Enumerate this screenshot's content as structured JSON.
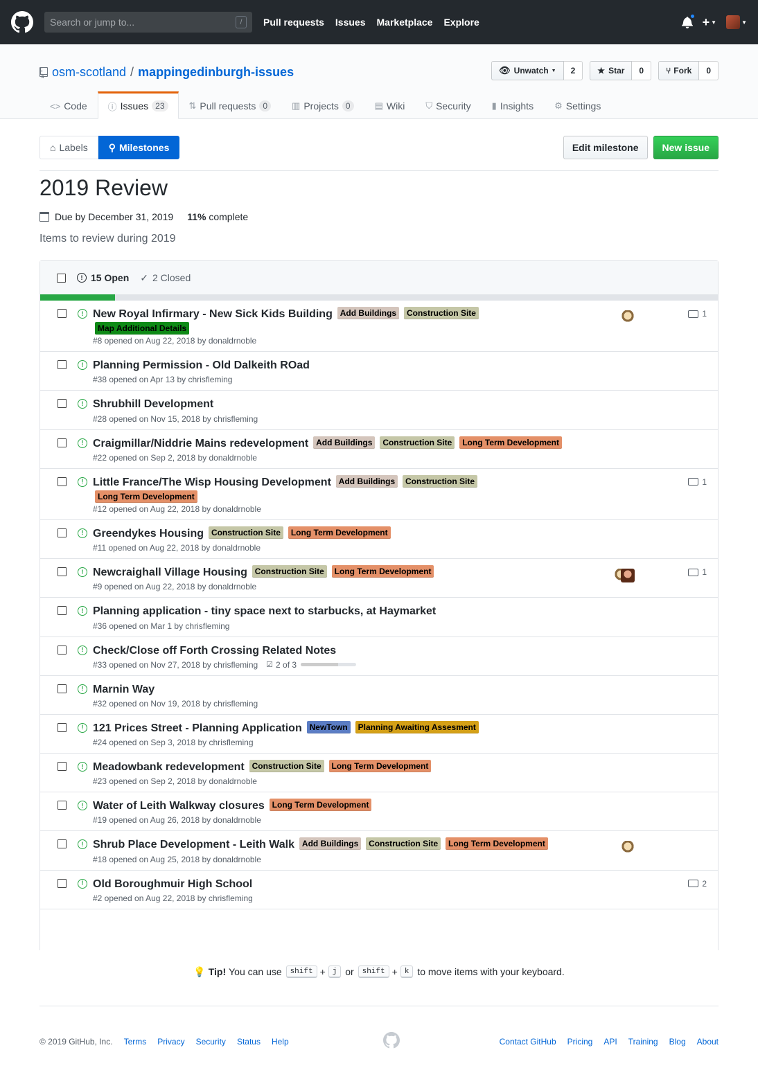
{
  "header": {
    "search_placeholder": "Search or jump to...",
    "search_key": "/",
    "nav": [
      "Pull requests",
      "Issues",
      "Marketplace",
      "Explore"
    ],
    "plus": "+"
  },
  "repo": {
    "owner": "osm-scotland",
    "separator": "/",
    "name": "mappingedinburgh-issues",
    "watch_label": "Unwatch",
    "watch_count": "2",
    "star_label": "Star",
    "star_count": "0",
    "fork_label": "Fork",
    "fork_count": "0"
  },
  "reponav": [
    {
      "label": "Code",
      "icon": "code-icon",
      "glyph": "<>",
      "counter": ""
    },
    {
      "label": "Issues",
      "icon": "issue-opened-icon",
      "glyph": "ⓘ",
      "counter": "23"
    },
    {
      "label": "Pull requests",
      "icon": "git-pull-request-icon",
      "glyph": "⇅",
      "counter": "0"
    },
    {
      "label": "Projects",
      "icon": "project-icon",
      "glyph": "▥",
      "counter": "0"
    },
    {
      "label": "Wiki",
      "icon": "book-icon",
      "glyph": "▤",
      "counter": ""
    },
    {
      "label": "Security",
      "icon": "shield-icon",
      "glyph": "⛉",
      "counter": ""
    },
    {
      "label": "Insights",
      "icon": "graph-icon",
      "glyph": "▮",
      "counter": ""
    },
    {
      "label": "Settings",
      "icon": "gear-icon",
      "glyph": "⚙",
      "counter": ""
    }
  ],
  "subnav": {
    "labels": "Labels",
    "milestones": "Milestones",
    "edit_milestone": "Edit milestone",
    "new_issue": "New issue"
  },
  "milestone": {
    "title": "2019 Review",
    "due": "Due by December 31, 2019",
    "percent": "11%",
    "percent_suffix": " complete",
    "progress_fraction": 0.11,
    "description": "Items to review during 2019"
  },
  "states": {
    "open": "15 Open",
    "closed": "2 Closed"
  },
  "label_colors": {
    "Add Buildings": "#d4c5bc",
    "Construction Site": "#c5c7a7",
    "Map Additional Details": "#0e8a16",
    "Long Term Development": "#e49068",
    "NewTown": "#5b7dc4",
    "Planning Awaiting Assesment": "#d4a017"
  },
  "issues": [
    {
      "title": "New Royal Infirmary - New Sick Kids Building",
      "labels": [
        "Add Buildings",
        "Construction Site",
        "Map Additional Details"
      ],
      "meta": "#8 opened on Aug 22, 2018 by donaldrnoble",
      "assignees": [
        "a1"
      ],
      "comments": "1"
    },
    {
      "title": "Planning Permission - Old Dalkeith ROad",
      "labels": [],
      "meta": "#38 opened on Apr 13 by chrisfleming",
      "assignees": [],
      "comments": ""
    },
    {
      "title": "Shrubhill Development",
      "labels": [],
      "meta": "#28 opened on Nov 15, 2018 by chrisfleming",
      "assignees": [],
      "comments": ""
    },
    {
      "title": "Craigmillar/Niddrie Mains redevelopment",
      "labels": [
        "Add Buildings",
        "Construction Site",
        "Long Term Development"
      ],
      "meta": "#22 opened on Sep 2, 2018 by donaldrnoble",
      "assignees": [],
      "comments": ""
    },
    {
      "title": "Little France/The Wisp Housing Development",
      "labels": [
        "Add Buildings",
        "Construction Site",
        "Long Term Development"
      ],
      "meta": "#12 opened on Aug 22, 2018 by donaldrnoble",
      "assignees": [],
      "comments": "1"
    },
    {
      "title": "Greendykes Housing",
      "labels": [
        "Construction Site",
        "Long Term Development"
      ],
      "meta": "#11 opened on Aug 22, 2018 by donaldrnoble",
      "assignees": [],
      "comments": ""
    },
    {
      "title": "Newcraighall Village Housing",
      "labels": [
        "Construction Site",
        "Long Term Development"
      ],
      "meta": "#9 opened on Aug 22, 2018 by donaldrnoble",
      "assignees": [
        "a1",
        "a2"
      ],
      "comments": "1"
    },
    {
      "title": "Planning application - tiny space next to starbucks, at Haymarket",
      "labels": [],
      "meta": "#36 opened on Mar 1 by chrisfleming",
      "assignees": [],
      "comments": ""
    },
    {
      "title": "Check/Close off Forth Crossing Related Notes",
      "labels": [],
      "meta": "#33 opened on Nov 27, 2018 by chrisfleming",
      "assignees": [],
      "comments": "",
      "checklist": "2 of 3",
      "checklist_fraction": 0.67
    },
    {
      "title": "Marnin Way",
      "labels": [],
      "meta": "#32 opened on Nov 19, 2018 by chrisfleming",
      "assignees": [],
      "comments": ""
    },
    {
      "title": "121 Prices Street - Planning Application",
      "labels": [
        "NewTown",
        "Planning Awaiting Assesment"
      ],
      "meta": "#24 opened on Sep 3, 2018 by chrisfleming",
      "assignees": [],
      "comments": ""
    },
    {
      "title": "Meadowbank redevelopment",
      "labels": [
        "Construction Site",
        "Long Term Development"
      ],
      "meta": "#23 opened on Sep 2, 2018 by donaldrnoble",
      "assignees": [],
      "comments": ""
    },
    {
      "title": "Water of Leith Walkway closures",
      "labels": [
        "Long Term Development"
      ],
      "meta": "#19 opened on Aug 26, 2018 by donaldrnoble",
      "assignees": [],
      "comments": ""
    },
    {
      "title": "Shrub Place Development - Leith Walk",
      "labels": [
        "Add Buildings",
        "Construction Site",
        "Long Term Development"
      ],
      "meta": "#18 opened on Aug 25, 2018 by donaldrnoble",
      "assignees": [
        "a1"
      ],
      "comments": ""
    },
    {
      "title": "Old Boroughmuir High School",
      "labels": [],
      "meta": "#2 opened on Aug 22, 2018 by chrisfleming",
      "assignees": [],
      "comments": "2"
    }
  ],
  "tip": {
    "lead": "Tip!",
    "text1": "You can use",
    "key_shift": "shift",
    "key_j": "j",
    "or": "or",
    "key_k": "k",
    "text2": "to move items with your keyboard."
  },
  "footer": {
    "copyright": "© 2019 GitHub, Inc.",
    "left_links": [
      "Terms",
      "Privacy",
      "Security",
      "Status",
      "Help"
    ],
    "right_links": [
      "Contact GitHub",
      "Pricing",
      "API",
      "Training",
      "Blog",
      "About"
    ]
  }
}
